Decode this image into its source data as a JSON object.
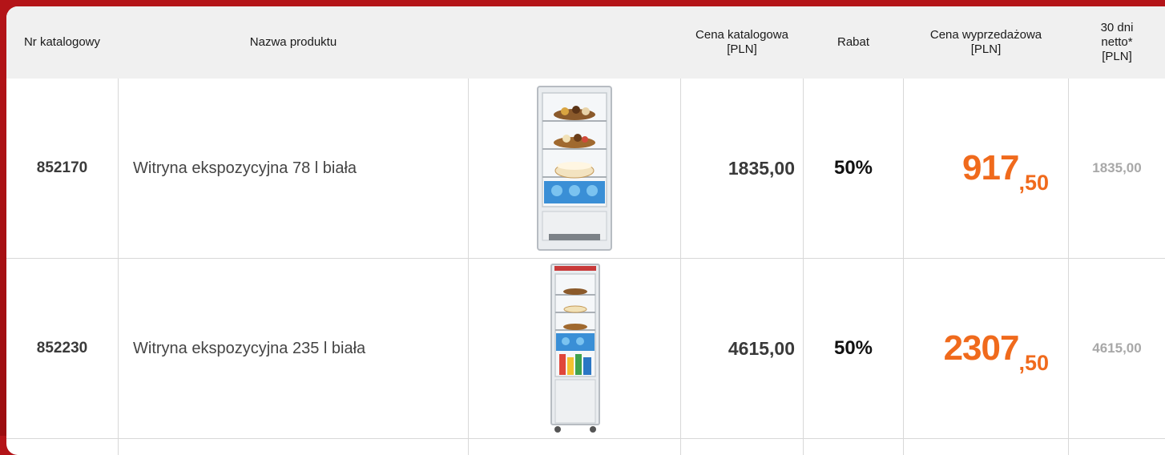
{
  "header": {
    "catalog_no": "Nr katalogowy",
    "product_name": "Nazwa produktu",
    "list_price": "Cena katalogowa\n[PLN]",
    "discount": "Rabat",
    "sale_price": "Cena wyprzedażowa\n[PLN]",
    "net30": "30 dni\nnetto*\n[PLN]"
  },
  "rows": [
    {
      "catalog_no": "852170",
      "name": "Witryna ekspozycyjna 78 l biała",
      "image_icon": "display-fridge-small-icon",
      "list_price": "1835,00",
      "discount": "50%",
      "sale_main": "917",
      "sale_fraction": ",50",
      "net30": "1835,00"
    },
    {
      "catalog_no": "852230",
      "name": "Witryna ekspozycyjna 235 l biała",
      "image_icon": "display-fridge-tall-icon",
      "list_price": "4615,00",
      "discount": "50%",
      "sale_main": "2307",
      "sale_fraction": ",50",
      "net30": "4615,00"
    }
  ],
  "colors": {
    "background": "#a80f12",
    "header_bg": "#f0f0f0",
    "sale_price": "#f06a1c",
    "net_price": "#a8a8a8"
  }
}
